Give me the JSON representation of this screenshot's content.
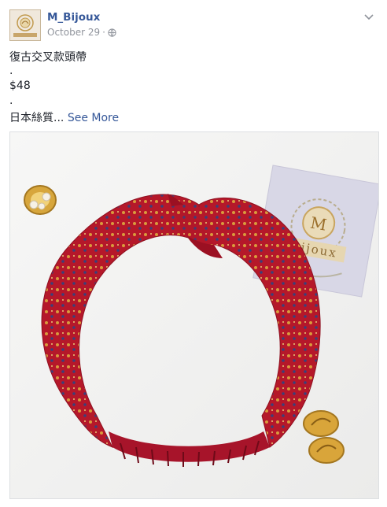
{
  "post": {
    "page_name": "M_Bijoux",
    "date": "October 29",
    "separator": "·",
    "lines": [
      "復古交叉款頭帶",
      ".",
      "$48",
      "."
    ],
    "last_line": "日本絲質...",
    "see_more": "See More"
  },
  "photo": {
    "card_text": "Bijoux",
    "card_initial": "M"
  },
  "icons": {
    "avatar": "brand-logo",
    "privacy": "globe-icon",
    "menu": "chevron-down-icon"
  },
  "colors": {
    "link": "#365899",
    "meta": "#90949c",
    "headband": "#b5182a",
    "gold": "#d4a640"
  }
}
